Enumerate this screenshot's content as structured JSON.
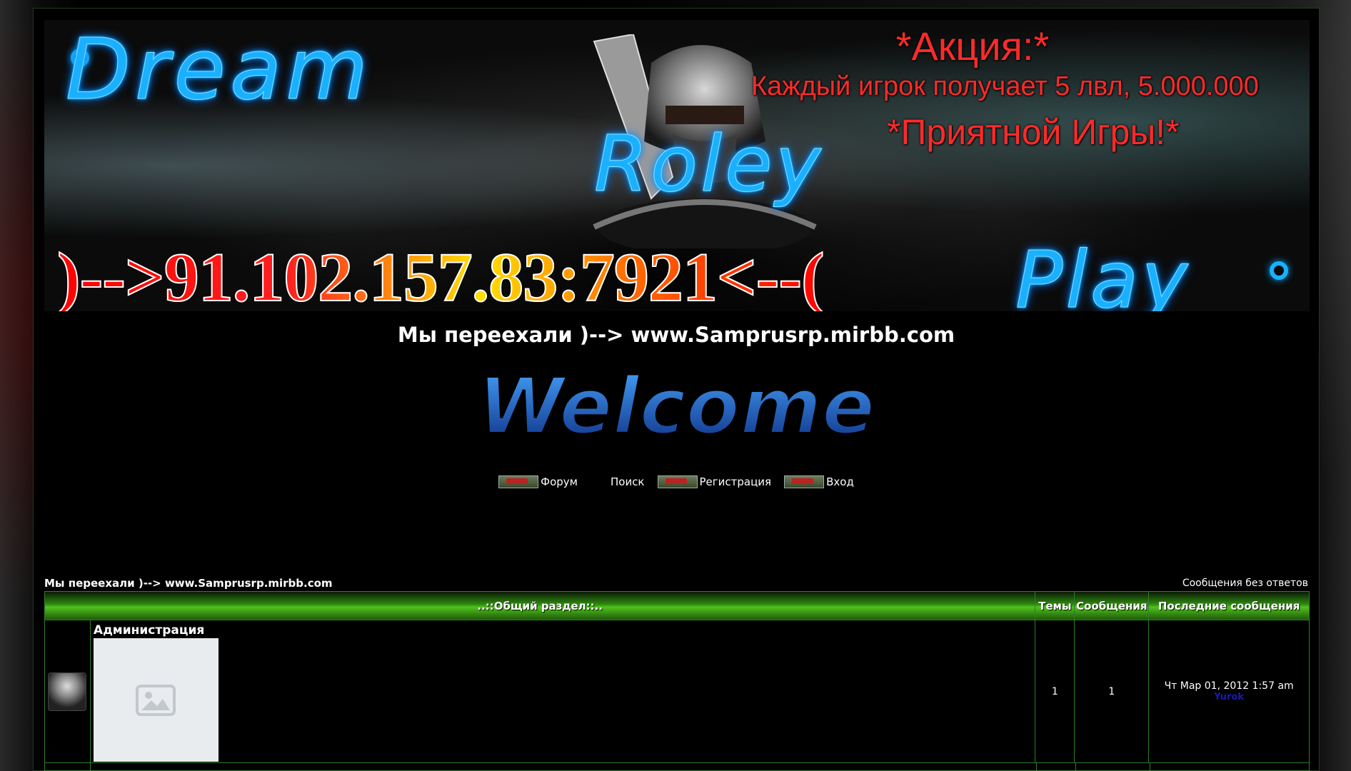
{
  "banner": {
    "title_dream": "Dream",
    "title_roley": "Roley",
    "title_play": "Play",
    "promo_line1": "*Акция:*",
    "promo_line2": "Каждый игрок получает 5 лвл, 5.000.000",
    "promo_line3": "*Приятной Игры!*",
    "ip_address": ")-->91.102.157.83:7921<--("
  },
  "moved_notice": "Мы переехали )--> www.Samprusrp.mirbb.com",
  "welcome_text": "Welcome",
  "nav": {
    "forum": "Форум",
    "search": "Поиск",
    "register": "Регистрация",
    "login": "Вход"
  },
  "breadcrumb": "Мы переехали )--> www.Samprusrp.mirbb.com",
  "unanswered_link": "Сообщения без ответов",
  "table": {
    "headers": {
      "section": "..::Общий раздел::..",
      "topics": "Темы",
      "posts": "Сообщения",
      "last_posts": "Последние сообщения"
    },
    "rows": [
      {
        "name": "Администрация",
        "topics": "1",
        "posts": "1",
        "last_date": "Чт Мар 01, 2012 1:57 am",
        "last_user": "Yurok"
      }
    ]
  },
  "colors": {
    "banner_title": "#1ab0ff",
    "promo_text": "#ff2a2a",
    "table_border": "#2e7d2e",
    "header_green": "#4fc21c",
    "user_link": "#1a1aaa"
  }
}
